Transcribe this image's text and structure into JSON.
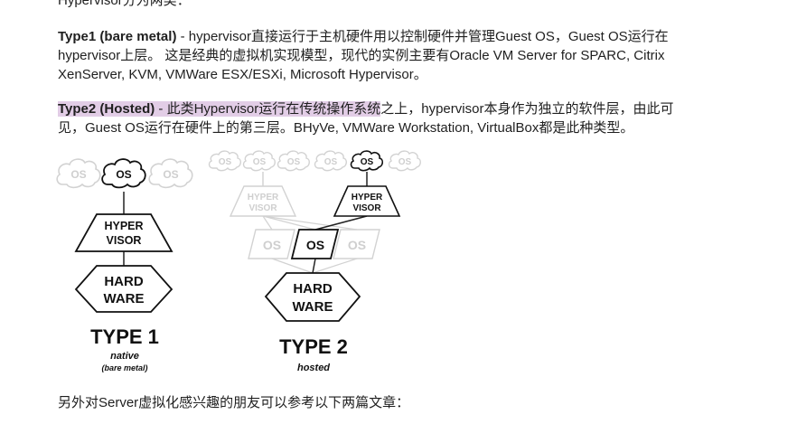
{
  "intro_cut": "Hypervisor分为两类：",
  "type1_para": {
    "term": "Type1 (bare metal)",
    "line1_rest": " - hypervisor直接运行于主机硬件用以控制硬件并管理Guest OS，Guest OS运行在",
    "line2": "hypervisor上层。 这是经典的虚拟机实现模型，现代的实例主要有Oracle VM Server for SPARC, Citrix",
    "line3": "XenServer, KVM, VMWare ESX/ESXi, Microsoft Hypervisor。"
  },
  "type2_para": {
    "term": "Type2 (Hosted)",
    "highlight": " - 此类Hypervisor运行在传统操作系统",
    "line1_rest": "之上，hypervisor本身作为独立的软件层，由此可",
    "line2": "见，Guest OS运行在硬件上的第三层。BHyVe, VMWare Workstation, VirtualBox都是此种类型。"
  },
  "diagram": {
    "os_label": "OS",
    "hyper_line1": "HYPER",
    "hyper_line2": "VISOR",
    "hard_line1": "HARD",
    "hard_line2": "WARE",
    "type1_title": "TYPE 1",
    "type1_sub1": "native",
    "type1_sub2": "(bare metal)",
    "type2_title": "TYPE 2",
    "type2_sub": "hosted"
  },
  "closing_line": "另外对Server虚拟化感兴趣的朋友可以参考以下两篇文章："
}
